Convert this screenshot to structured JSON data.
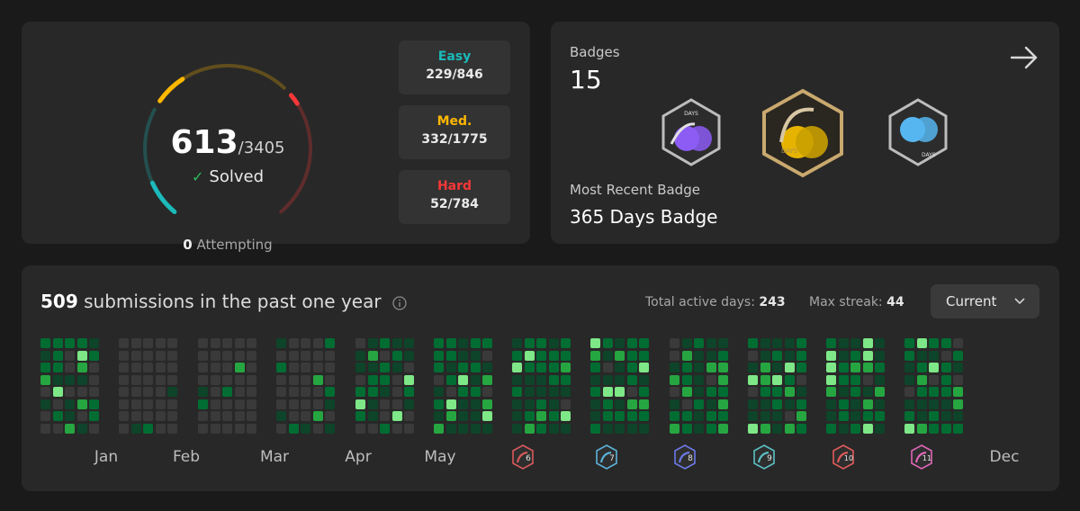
{
  "stats": {
    "solved": "613",
    "total": "/3405",
    "solved_label": "Solved",
    "attempting_count": "0",
    "attempting_label": "Attempting",
    "progress": {
      "easy": 0.271,
      "medium": 0.187,
      "hard": 0.066
    },
    "difficulties": [
      {
        "name": "Easy",
        "count": "229/846",
        "color": "#1cbaba"
      },
      {
        "name": "Med.",
        "count": "332/1775",
        "color": "#ffb700"
      },
      {
        "name": "Hard",
        "count": "52/784",
        "color": "#f63737"
      }
    ]
  },
  "badges": {
    "label": "Badges",
    "count": "15",
    "recent_label": "Most Recent Badge",
    "recent_name": "365 Days Badge",
    "items": [
      {
        "icon": "200-days-badge-icon",
        "color": "#8c5cf5",
        "text": "DAYS"
      },
      {
        "icon": "365-days-badge-icon",
        "color": "#e6b400",
        "text": "DAYS"
      },
      {
        "icon": "100-days-badge-icon",
        "color": "#56b6f0",
        "text": "DAYS"
      }
    ]
  },
  "heatmap": {
    "count": "509",
    "title": "submissions in the past one year",
    "active_days_label": "Total active days:",
    "active_days": "243",
    "max_streak_label": "Max streak:",
    "max_streak": "44",
    "select_value": "Current",
    "months": [
      "Jan",
      "Feb",
      "Mar",
      "Apr",
      "May",
      "Dec"
    ],
    "month_badges": [
      {
        "icon": "june-badge-icon",
        "number": "6",
        "color": "#d8595b"
      },
      {
        "icon": "july-badge-icon",
        "number": "7",
        "color": "#5ab3d9"
      },
      {
        "icon": "august-badge-icon",
        "number": "8",
        "color": "#6d7ae6"
      },
      {
        "icon": "september-badge-icon",
        "number": "9",
        "color": "#5ac0c4"
      },
      {
        "icon": "october-badge-icon",
        "number": "10",
        "color": "#e05a5a"
      },
      {
        "icon": "november-badge-icon",
        "number": "11",
        "color": "#e067b8"
      }
    ],
    "colors": {
      "empty": "#3a3a3a",
      "level1": "#0e4429",
      "level2": "#016d32",
      "level3": "#26a641",
      "level4": "#7ee787"
    }
  }
}
